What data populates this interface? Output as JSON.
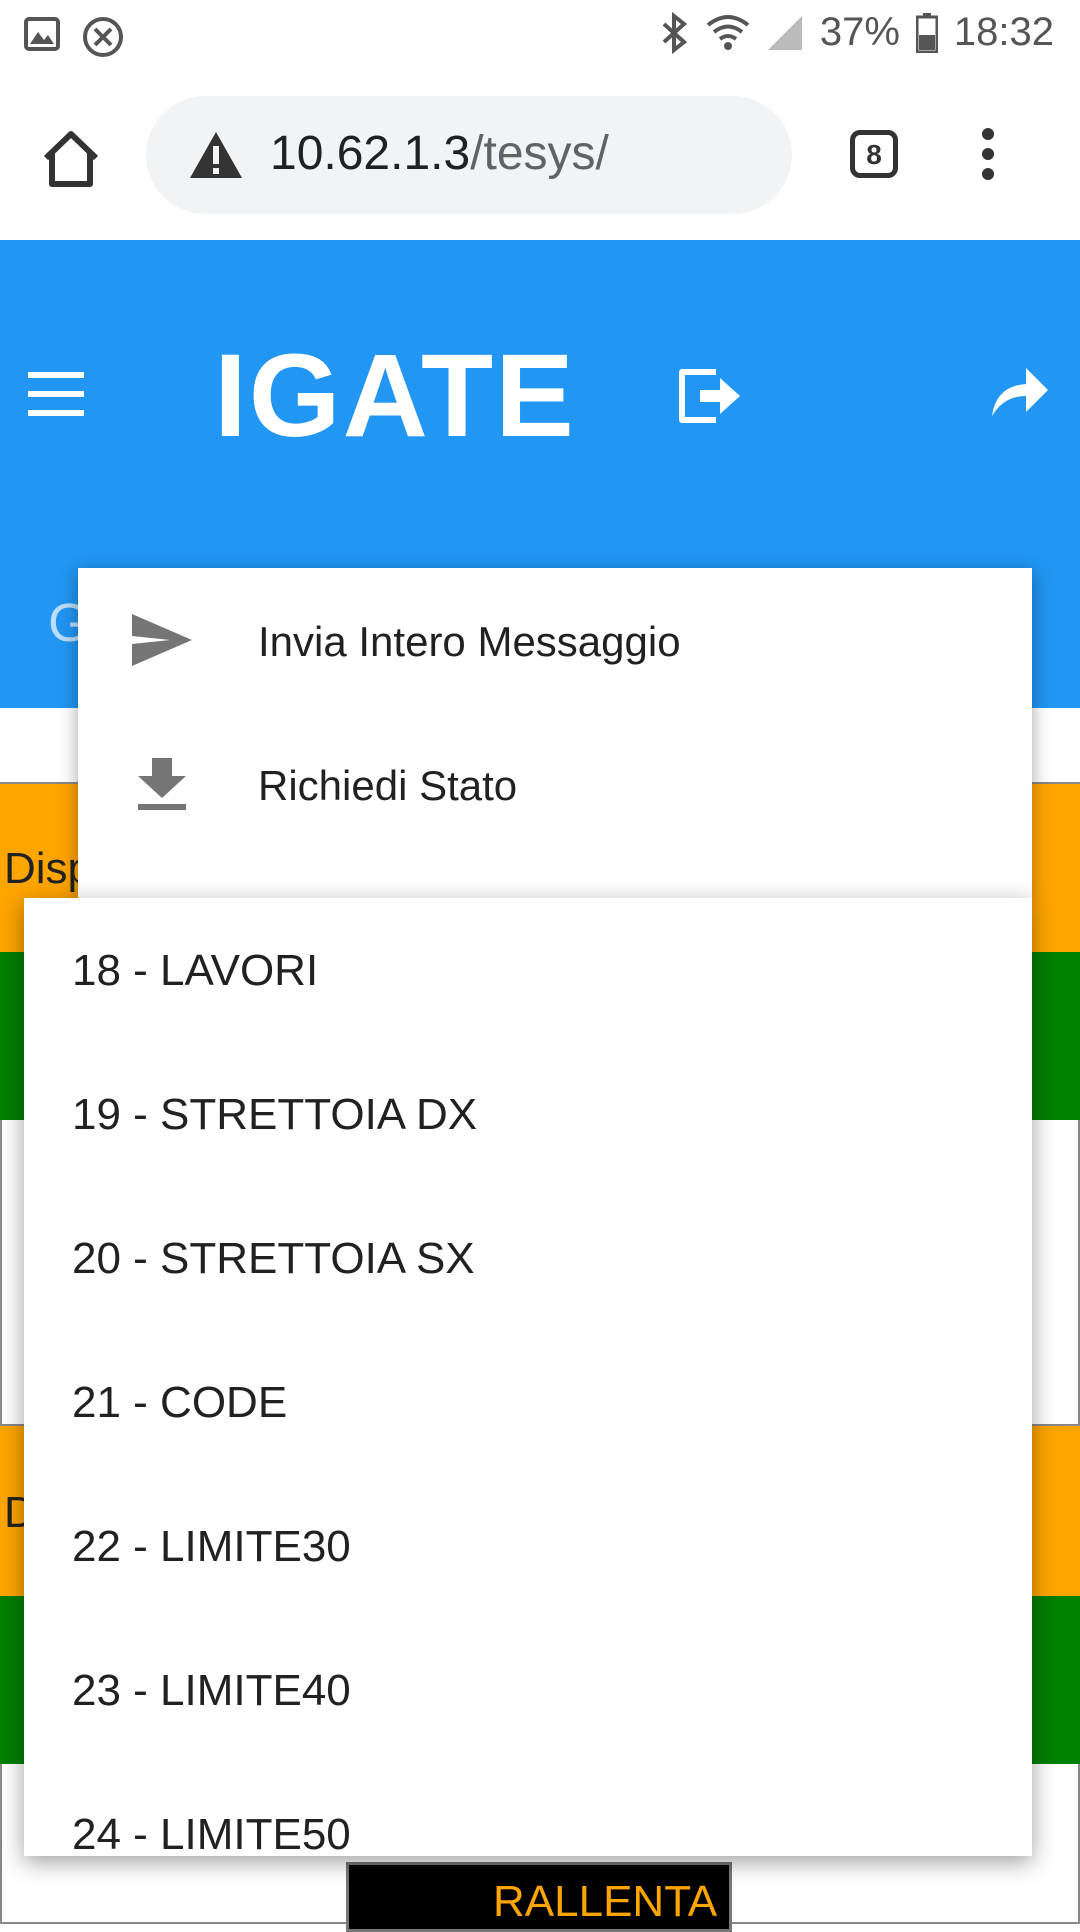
{
  "status_bar": {
    "battery": "37%",
    "time": "18:32"
  },
  "browser": {
    "url_host": "10.62.1.3",
    "url_path": "/tesys/",
    "tab_count": "8"
  },
  "app": {
    "title": "IGATE",
    "subtitle_partial": "G",
    "colors": {
      "header": "#2196f3",
      "orange": "#ffa500",
      "green": "#008000"
    }
  },
  "background": {
    "label_1": "Disp",
    "label_2": "D",
    "sign_text": "RALLENTA"
  },
  "overflow_menu": {
    "items": [
      {
        "label": "Invia Intero Messaggio",
        "icon": "send-icon"
      },
      {
        "label": "Richiedi Stato",
        "icon": "download-icon"
      }
    ]
  },
  "dropdown": {
    "options": [
      "18 - LAVORI",
      "19 - STRETTOIA DX",
      "20 - STRETTOIA SX",
      "21 - CODE",
      "22 - LIMITE30",
      "23 - LIMITE40",
      "24 - LIMITE50"
    ]
  }
}
